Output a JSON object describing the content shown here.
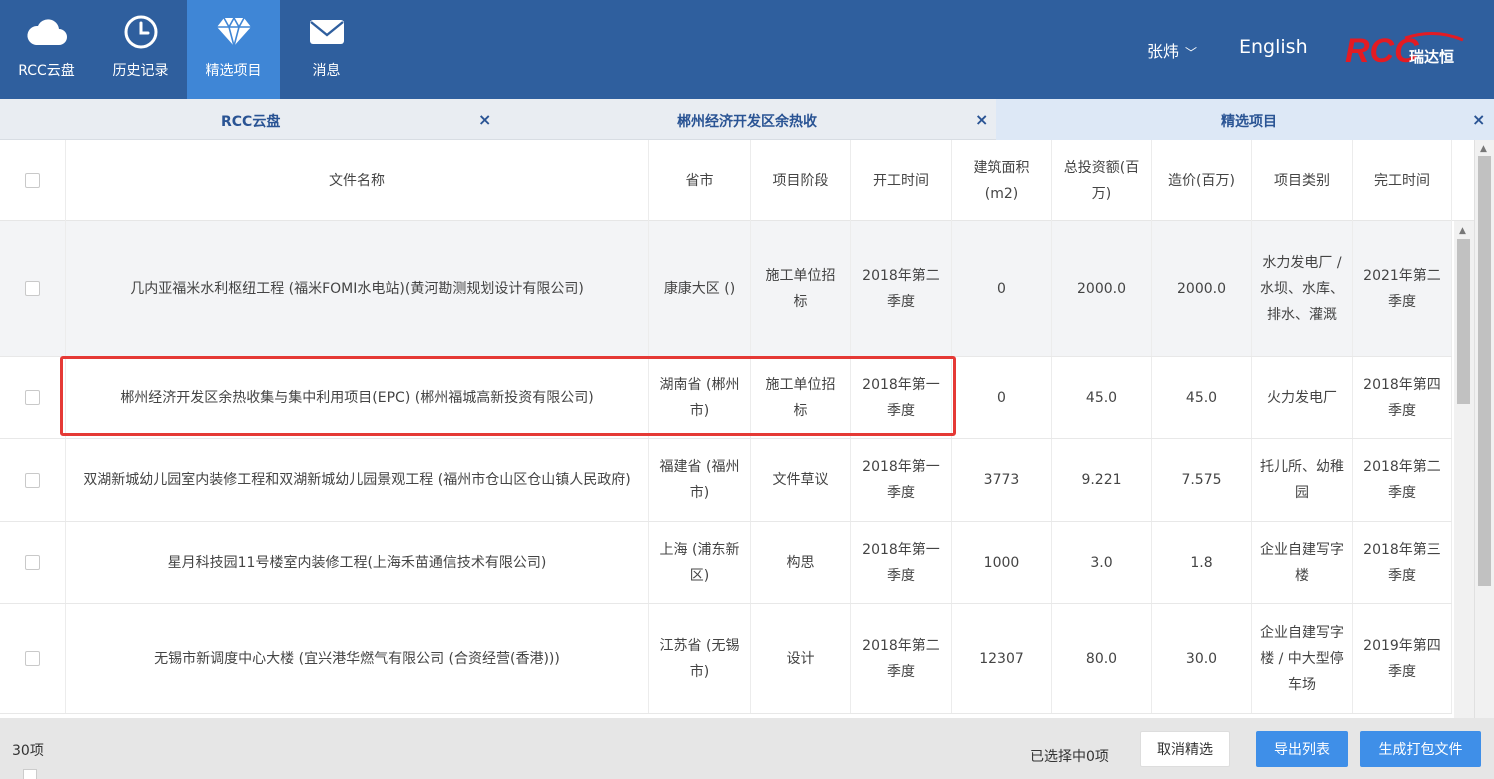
{
  "nav": {
    "items": [
      {
        "label": "RCC云盘",
        "icon": "cloud-icon"
      },
      {
        "label": "历史记录",
        "icon": "clock-icon"
      },
      {
        "label": "精选项目",
        "icon": "diamond-icon"
      },
      {
        "label": "消息",
        "icon": "mail-icon"
      }
    ],
    "user": "张炜",
    "language": "English",
    "logo_text": "RCC",
    "logo_sub": "瑞达恒"
  },
  "tabs": [
    {
      "label": "RCC云盘"
    },
    {
      "label": "郴州经济开发区余热收"
    },
    {
      "label": "精选项目"
    }
  ],
  "table": {
    "headers": [
      "文件名称",
      "省市",
      "项目阶段",
      "开工时间",
      "建筑面积(m2)",
      "总投资额(百万)",
      "造价(百万)",
      "项目类别",
      "完工时间"
    ],
    "rows": [
      {
        "name": "几内亚福米水利枢纽工程 (福米FOMI水电站)(黄河勘测规划设计有限公司)",
        "province": "康康大区 ()",
        "stage": "施工单位招标",
        "start": "2018年第二季度",
        "area": "0",
        "investment": "2000.0",
        "cost": "2000.0",
        "category": "水力发电厂 / 水坝、水库、排水、灌溉",
        "finish": "2021年第二季度"
      },
      {
        "name": "郴州经济开发区余热收集与集中利用项目(EPC) (郴州福城高新投资有限公司)",
        "province": "湖南省 (郴州市)",
        "stage": "施工单位招标",
        "start": "2018年第一季度",
        "area": "0",
        "investment": "45.0",
        "cost": "45.0",
        "category": "火力发电厂",
        "finish": "2018年第四季度"
      },
      {
        "name": "双湖新城幼儿园室内装修工程和双湖新城幼儿园景观工程 (福州市仓山区仓山镇人民政府)",
        "province": "福建省 (福州市)",
        "stage": "文件草议",
        "start": "2018年第一季度",
        "area": "3773",
        "investment": "9.221",
        "cost": "7.575",
        "category": "托儿所、幼稚园",
        "finish": "2018年第二季度"
      },
      {
        "name": "星月科技园11号楼室内装修工程(上海禾苗通信技术有限公司)",
        "province": "上海 (浦东新区)",
        "stage": "构思",
        "start": "2018年第一季度",
        "area": "1000",
        "investment": "3.0",
        "cost": "1.8",
        "category": "企业自建写字楼",
        "finish": "2018年第三季度"
      },
      {
        "name": "无锡市新调度中心大楼 (宜兴港华燃气有限公司 (合资经营(香港)))",
        "province": "江苏省 (无锡市)",
        "stage": "设计",
        "start": "2018年第二季度",
        "area": "12307",
        "investment": "80.0",
        "cost": "30.0",
        "category": "企业自建写字楼 / 中大型停车场",
        "finish": "2019年第四季度"
      }
    ]
  },
  "footer": {
    "count": "30项",
    "selected": "已选择中0项",
    "cancel_label": "取消精选",
    "export_label": "导出列表",
    "package_label": "生成打包文件"
  },
  "colors": {
    "topbar": "#2f5f9e",
    "active_nav": "#3f86d6",
    "primary_button": "#3f8fe8",
    "highlight": "#e53935"
  }
}
